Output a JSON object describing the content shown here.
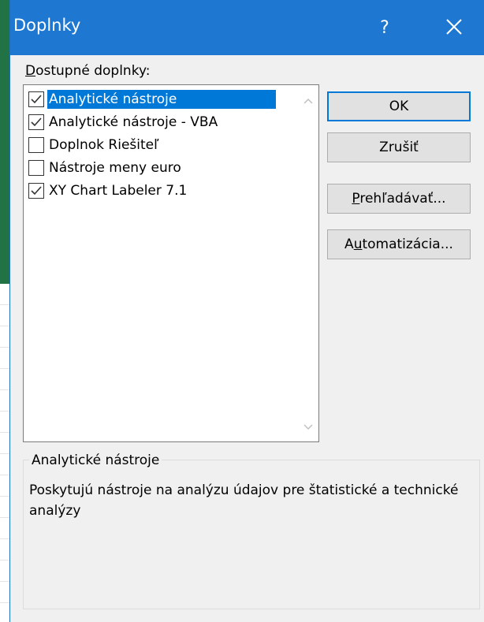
{
  "dialog": {
    "title": "Doplnky",
    "help_label": "?",
    "available_label_first": "D",
    "available_label_rest": "ostupné doplnky:"
  },
  "addins": [
    {
      "label": "Analytické nástroje",
      "checked": true,
      "selected": true
    },
    {
      "label": "Analytické nástroje - VBA",
      "checked": true,
      "selected": false
    },
    {
      "label": "Doplnok Riešiteľ",
      "checked": false,
      "selected": false
    },
    {
      "label": "Nástroje meny euro",
      "checked": false,
      "selected": false
    },
    {
      "label": "XY Chart Labeler 7.1",
      "checked": true,
      "selected": false
    }
  ],
  "buttons": {
    "ok": "OK",
    "cancel": "Zrušiť",
    "browse_first": "P",
    "browse_rest": "rehľadávať...",
    "automation_first": "A",
    "automation_u": "u",
    "automation_rest": "tomatizácia..."
  },
  "description": {
    "title": "Analytické nástroje",
    "text": "Poskytujú nástroje na analýzu údajov pre štatistické a technické analýzy"
  },
  "colors": {
    "titlebar": "#1e78d2",
    "selection": "#0078d7",
    "background_app": "#217346"
  }
}
